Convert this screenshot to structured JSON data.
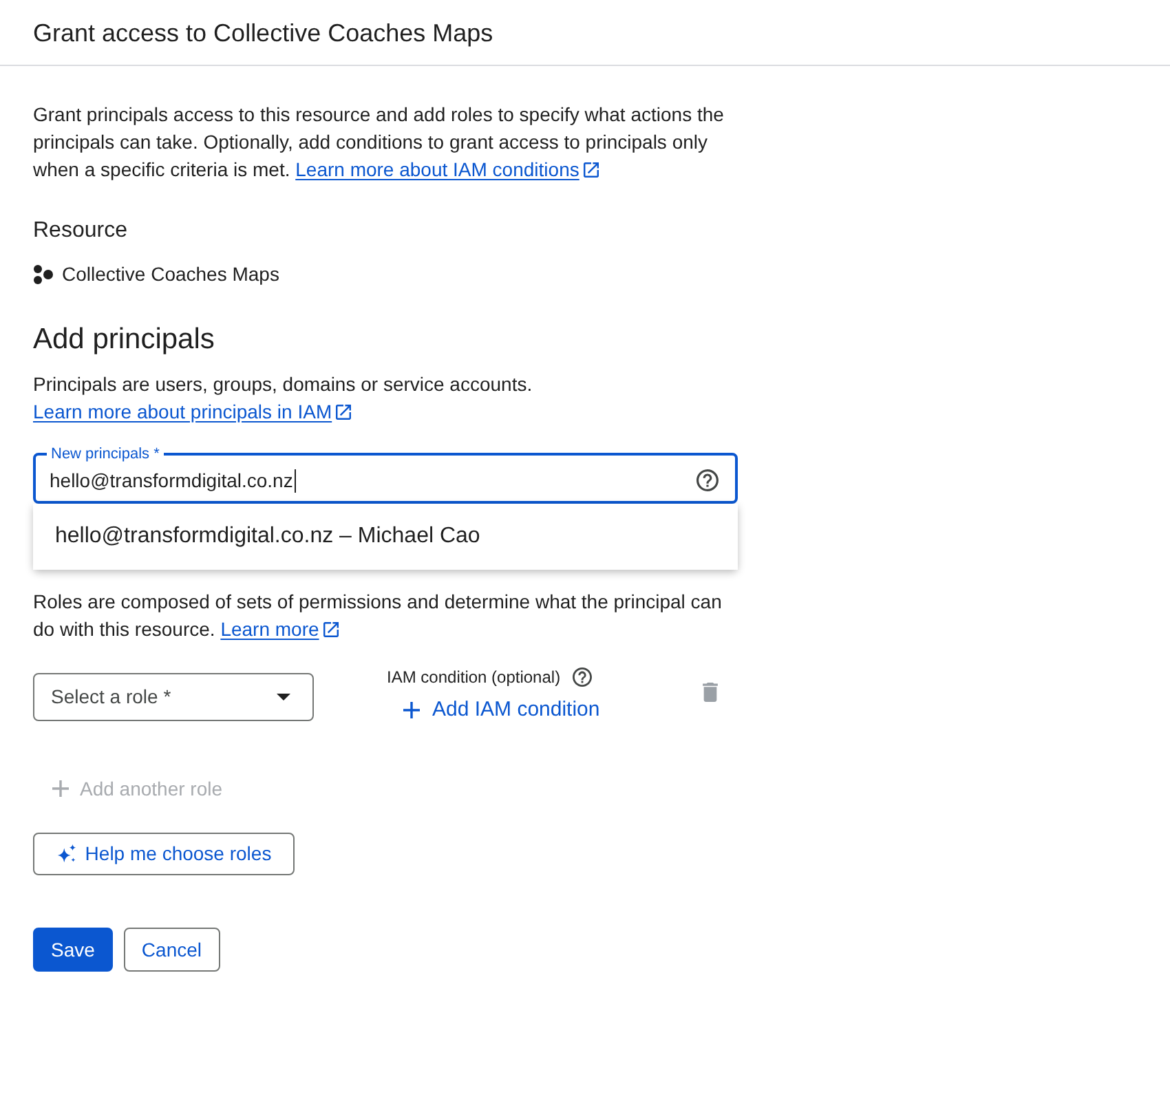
{
  "dialog": {
    "title": "Grant access to Collective Coaches Maps"
  },
  "intro": {
    "text": "Grant principals access to this resource and add roles to specify what actions the principals can take. Optionally, add conditions to grant access to principals only when a specific criteria is met.",
    "link": "Learn more about IAM conditions"
  },
  "resource": {
    "heading": "Resource",
    "name": "Collective Coaches Maps"
  },
  "principals": {
    "heading": "Add principals",
    "description": "Principals are users, groups, domains or service accounts.",
    "link": "Learn more about principals in IAM",
    "field": {
      "label": "New principals *",
      "value": "hello@transformdigital.co.nz",
      "focused": true
    },
    "suggestions": [
      {
        "label": "hello@transformdigital.co.nz – Michael Cao",
        "selected": false
      }
    ]
  },
  "roles": {
    "description": "Roles are composed of sets of permissions and determine what the principal can do with this resource.",
    "link": "Learn more",
    "role_select": {
      "placeholder": "Select a role *"
    },
    "condition": {
      "label": "IAM condition (optional)",
      "button": "Add IAM condition"
    },
    "add_another": {
      "label": "Add another role",
      "disabled": true
    },
    "help_button": "Help me choose roles"
  },
  "actions": [
    {
      "label": "Save",
      "kind": "primary"
    },
    {
      "label": "Cancel",
      "kind": "secondary"
    }
  ]
}
